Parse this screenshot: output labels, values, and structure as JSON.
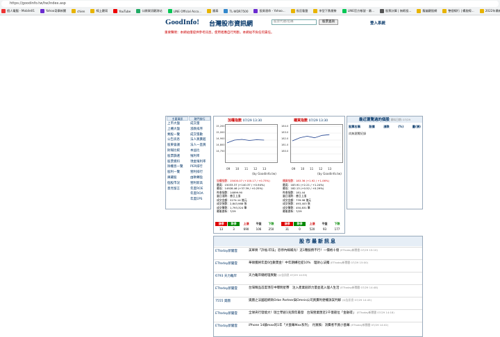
{
  "browser": {
    "url": "https://goodinfo.tw/tw/index.asp",
    "bookmarks": [
      {
        "label": "個人電腦 - Mobile01",
        "color": "#e33"
      },
      {
        "label": "Yahoo奇摩新聞",
        "color": "#6b2bd0"
      },
      {
        "label": "chien",
        "color": "#e8b400"
      },
      {
        "label": "線上聽寫",
        "color": "#e8b400"
      },
      {
        "label": "YouTube",
        "color": "#e00"
      },
      {
        "label": "公開資訊觀測站",
        "color": "#2a6"
      },
      {
        "label": "LINE Official Acco...",
        "color": "#06c755"
      },
      {
        "label": "國泰",
        "color": "#e8b400"
      },
      {
        "label": "TL-WDR7500",
        "color": "#38c"
      },
      {
        "label": "投資達命 - Yahoo...",
        "color": "#6b2bd0"
      },
      {
        "label": "長匡看盤",
        "color": "#e8b400"
      },
      {
        "label": "李型下跌趨勢",
        "color": "#e8b400"
      },
      {
        "label": "LINE官方帳號 - 最...",
        "color": "#06c755"
      },
      {
        "label": "股票計算 | 無暇投...",
        "color": "#555"
      },
      {
        "label": "龍貓觀股網",
        "color": "#e8b400"
      },
      {
        "label": "整個線行 | 螺旋線...",
        "color": "#e8b400"
      },
      {
        "label": "2022年最新股票...",
        "color": "#e8b400"
      },
      {
        "label": "Ter",
        "color": "#555"
      }
    ]
  },
  "header": {
    "logo_main": "GoodInfo!",
    "site_name": "台灣股市資訊網",
    "search_placeholder": "股票代號/名稱",
    "search_button": "股票查詢",
    "login": "登入系統",
    "notice": "重要聲明：本網站僅提供參考訊息，使用者應自行判斷，本網站不負任何責任。"
  },
  "left_menu": {
    "col1_head": "主要資訊",
    "col2_head": "熱門排行",
    "col1": [
      "上市大盤",
      "上櫃大盤",
      "類股一覽",
      "公告訊息",
      "股東會議",
      "財報比較",
      "股票篩選",
      "股票資料",
      "除權息一覽",
      "股利一覽",
      "庫藏股",
      "個股市況",
      "意見留言"
    ],
    "col2": [
      "成交量",
      "漲跌排序",
      "成交張數",
      "法人買賣超",
      "法人一直買",
      "本益比",
      "殖利率",
      "現金殖利率",
      "PER排行",
      "營利排行",
      "由軟轉盈",
      "營利新高",
      "年度ROE",
      "年度ROA",
      "年度EPS"
    ]
  },
  "market": {
    "listed": {
      "title": "加權指數",
      "time": "07/29 13:30",
      "yticks": [
        "15,200",
        "15,000",
        "14,900",
        "14,800",
        "14,750"
      ],
      "xticks": [
        "09",
        "10",
        "11",
        "12",
        "13"
      ],
      "credit": "(by Goodinfo.tw)",
      "stats": [
        "加權指數：15000.07 (+100.17 / +0.73%)",
        "最高：15033.37 (+140.37 / +0.94%)",
        "最低：14928.46 (+37.39 / +0.25%)",
        "昨收指數：14899.90",
        "當日漲跌：普日上漲",
        "成交金額：2274.14 億元",
        "成交張數：2,843,988 張",
        "成交筆數：1,793,324 筆",
        "最後更新：7/29"
      ],
      "updown": {
        "labels": [
          "漲停",
          "跌停",
          "上漲",
          "平盤",
          "下跌"
        ],
        "values": [
          "13",
          "3",
          "690",
          "106",
          "250"
        ]
      }
    },
    "otc": {
      "title": "櫃買指數",
      "time": "07/29 13:30",
      "yticks": [
        "184.0",
        "183.0",
        "182.0",
        "181.0",
        "180.0"
      ],
      "xticks": [
        "09",
        "10",
        "11",
        "12",
        "13"
      ],
      "credit": "(by Goodinfo.tw)",
      "stats": [
        "櫃買指數：183.36 (+1.92 / +1.06%)",
        "最高：183.91 (+2.21 / +1.24%)",
        "最低：182.13 (+0.52 / +0.29%)",
        "昨收指數：181.44",
        "當日漲跌：普日上漲",
        "成交金額：739.98 億元",
        "成交張數：493,403 張",
        "成交筆數：450,831 筆",
        "最後更新：7/29"
      ],
      "updown": {
        "labels": [
          "漲停",
          "跌停",
          "上漲",
          "平盤",
          "下跌"
        ],
        "values": [
          "31",
          "0",
          "520",
          "93",
          "177"
        ]
      }
    }
  },
  "recent": {
    "title": "最近瀏覽過的個股",
    "sub": "資料日期: 07/29",
    "headers": [
      "股票名稱",
      "股價",
      "漲跌",
      "(%)",
      "量(張)"
    ],
    "empty": "尚無瀏覽紀錄"
  },
  "news": {
    "title": "股市最新訊息",
    "items": [
      {
        "src": "ETtoday新聞雲",
        "text": "美軍將「許福.印法」恐停內線補光！這1種服務不行！一價格十億",
        "meta": "(ETtoday新聞雲 07/29 15:10)"
      },
      {
        "src": "ETtoday新聞雲",
        "text": "華碩獲將年度6位數獎金！中年期構社提10%　理財心法獨",
        "meta": "(ETtoday新聞雲 07/29 15:00)"
      },
      {
        "src": "6793 天力離岸",
        "text": "天力離岸總經理異動",
        "meta": "(公告訊息 07/29 14:55)"
      },
      {
        "src": "ETtoday新聞雲",
        "text": "台灣精品首度現在中曝明星賽　注入產業創新力量並進入個人生活",
        "meta": "(ETtoday新聞雲 07/29 14:48)"
      },
      {
        "src": "7555 奧圖",
        "text": "奧圖之法國超網商Orbe Partner與Omnis公司買賣利便權訴案判解",
        "meta": "(公告訊息 07/29 14:45)"
      },
      {
        "src": "ETtoday新聞雲",
        "text": "全球央行發燒大！瑞士學創1兆潤年最發　台灣營業匯近2千億搶位「金融得」",
        "meta": "(ETtoday新聞雲 07/29 14:18)"
      },
      {
        "src": "ETtoday新聞雲",
        "text": "iPhone 14蘋max的1年「大螢幕Max系列」　丹買稿：消費者不買小螢幕",
        "meta": "(ETtoday新聞雲 07/29 14:02)"
      }
    ]
  },
  "chart_data": [
    {
      "type": "line",
      "title": "加權指數",
      "x": [
        "09",
        "10",
        "11",
        "12",
        "13"
      ],
      "series": [
        {
          "values": [
            14960,
            15000,
            15010,
            14995,
            15005,
            15000
          ]
        }
      ],
      "ylim": [
        14700,
        15200
      ]
    },
    {
      "type": "line",
      "title": "櫃買指數",
      "x": [
        "09",
        "10",
        "11",
        "12",
        "13"
      ],
      "series": [
        {
          "values": [
            182.6,
            183.0,
            183.2,
            183.0,
            183.3,
            183.4
          ]
        }
      ],
      "ylim": [
        180.0,
        184.5
      ]
    }
  ]
}
